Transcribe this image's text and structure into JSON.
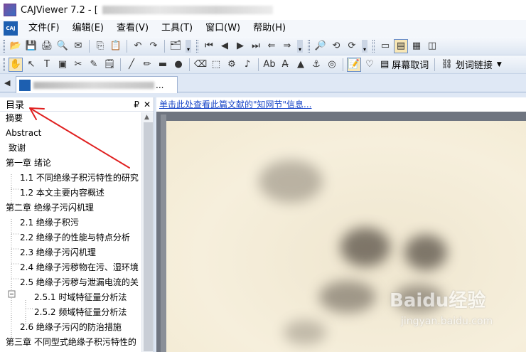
{
  "window": {
    "title": "CAJViewer 7.2 - [",
    "app_icon": "app-logo-icon"
  },
  "menu": {
    "items": [
      "文件(F)",
      "编辑(E)",
      "查看(V)",
      "工具(T)",
      "窗口(W)",
      "帮助(H)"
    ],
    "logo_text": "CAJ"
  },
  "toolbar2": {
    "screen_word_label": "屏幕取词",
    "link_label": "划词链接"
  },
  "tab": {
    "ellipsis": "..."
  },
  "sidebar": {
    "title": "目录",
    "pin_glyph": "₽",
    "close_glyph": "✕",
    "items": [
      {
        "label": "摘要",
        "level": 0
      },
      {
        "label": "Abstract",
        "level": 0
      },
      {
        "label": "致谢",
        "level": 0
      },
      {
        "label": "第一章 绪论",
        "level": 0
      },
      {
        "label": "1.1 不同绝缘子积污特性的研究",
        "level": 1
      },
      {
        "label": "1.2 本文主要内容概述",
        "level": 1
      },
      {
        "label": "第二章 绝缘子污闪机理",
        "level": 0
      },
      {
        "label": "2.1 绝缘子积污",
        "level": 1
      },
      {
        "label": "2.2 绝缘子的性能与特点分析",
        "level": 1
      },
      {
        "label": "2.3 绝缘子污闪机理",
        "level": 1
      },
      {
        "label": "2.4 绝缘子污秽物在污、湿环境",
        "level": 1
      },
      {
        "label": "2.5 绝缘子污秽与泄漏电流的关",
        "level": 1
      },
      {
        "label": "2.5.1 时域特征量分析法",
        "level": 2
      },
      {
        "label": "2.5.2 频域特征量分析法",
        "level": 2
      },
      {
        "label": "2.6 绝缘子污闪的防治措施",
        "level": 1
      },
      {
        "label": "第三章 不同型式绝缘子积污特性的",
        "level": 0
      }
    ]
  },
  "main": {
    "info_link": "单击此处查看此篇文献的\"知网节\"信息..."
  },
  "watermark": {
    "brand": "Baidu经验",
    "url": "jingyan.baidu.com"
  },
  "colors": {
    "link": "#1a47c8",
    "annotation_arrow": "#e02020",
    "toolbar_bg": "#dde6f2"
  }
}
